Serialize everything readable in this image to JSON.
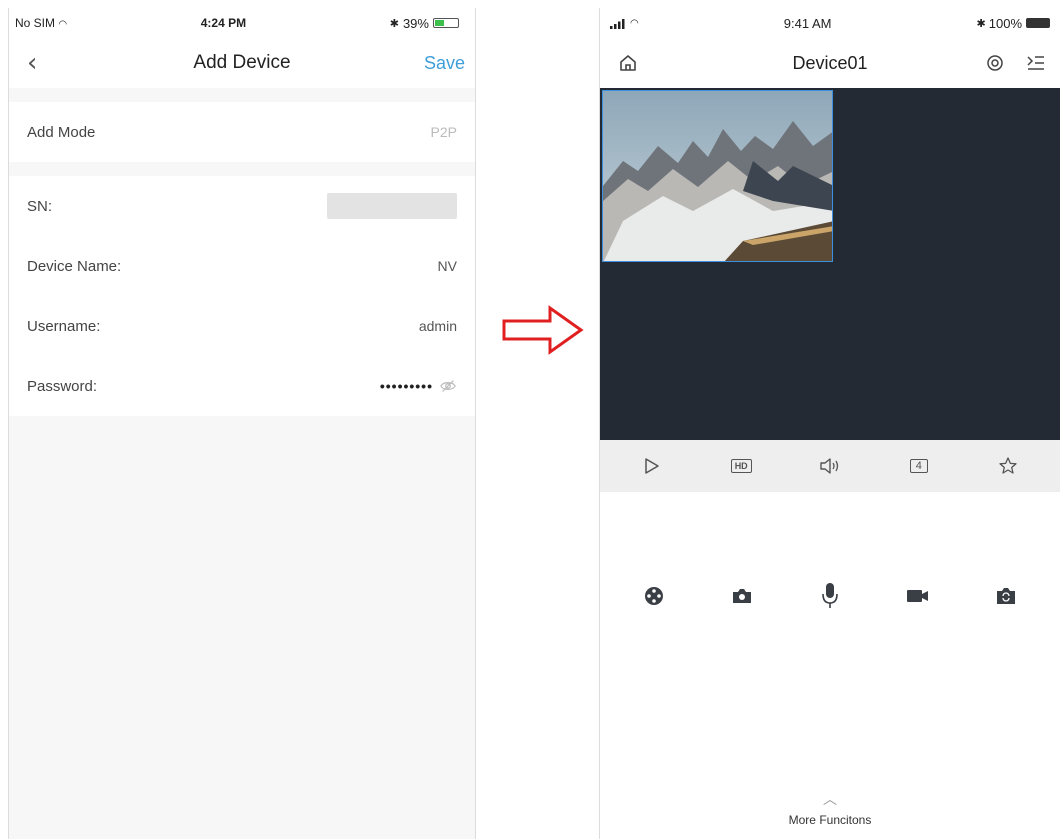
{
  "left_phone": {
    "status_bar": {
      "carrier": "No SIM",
      "time": "4:24 PM",
      "battery": "39%"
    },
    "nav": {
      "title": "Add Device",
      "save_label": "Save"
    },
    "add_mode": {
      "label": "Add Mode",
      "value": "P2P"
    },
    "fields": {
      "sn": {
        "label": "SN:"
      },
      "device_name": {
        "label": "Device Name:",
        "value": "NV"
      },
      "username": {
        "label": "Username:",
        "value": "admin"
      },
      "password": {
        "label": "Password:",
        "value": "•••••••••"
      }
    }
  },
  "right_phone": {
    "status_bar": {
      "time": "9:41 AM",
      "battery": "100%"
    },
    "nav": {
      "title": "Device01"
    },
    "controls": [
      "play-icon",
      "hd-icon",
      "volume-icon",
      "split-4-icon",
      "favorite-star-icon"
    ],
    "controls_hd_label": "HD",
    "controls_split_label": "4",
    "actions": [
      "ptz-icon",
      "snapshot-camera-icon",
      "microphone-icon",
      "record-video-icon",
      "switch-camera-icon"
    ],
    "more_label": "More Funcitons"
  },
  "colors": {
    "accent": "#3d9ed9",
    "video_bg": "#232a33",
    "arrow": "#e02020"
  }
}
